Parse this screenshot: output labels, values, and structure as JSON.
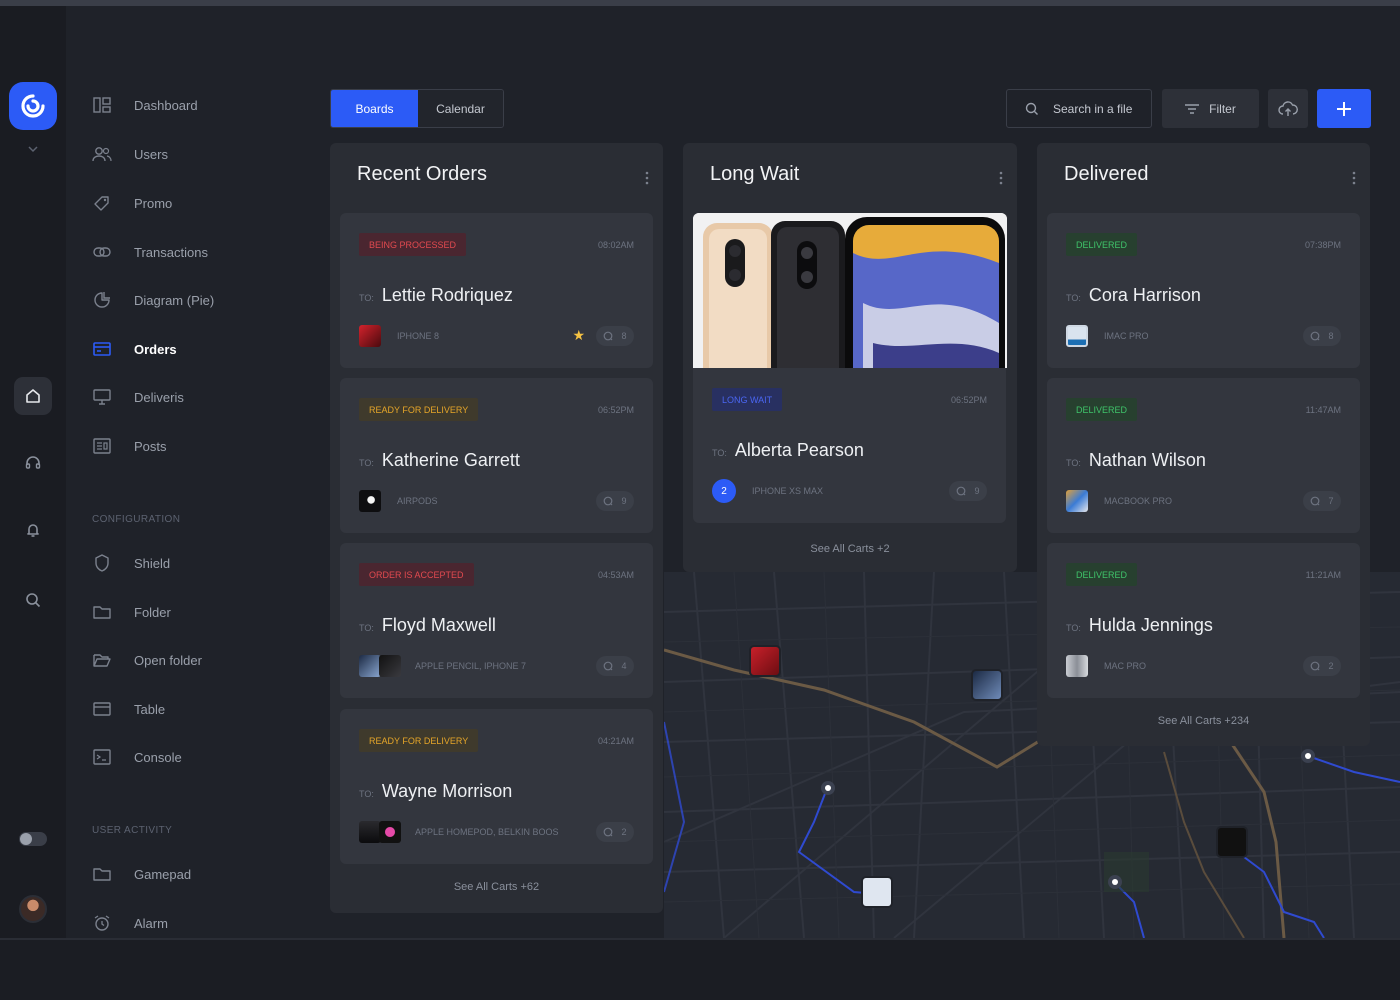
{
  "nav": {
    "items": [
      {
        "label": "Dashboard"
      },
      {
        "label": "Users"
      },
      {
        "label": "Promo"
      },
      {
        "label": "Transactions"
      },
      {
        "label": "Diagram (Pie)"
      },
      {
        "label": "Orders"
      },
      {
        "label": "Deliveris"
      },
      {
        "label": "Posts"
      }
    ],
    "config_heading": "CONFIGURATION",
    "config_items": [
      {
        "label": "Shield"
      },
      {
        "label": "Folder"
      },
      {
        "label": "Open folder"
      },
      {
        "label": "Table"
      },
      {
        "label": "Console"
      }
    ],
    "activity_heading": "USER ACTIVITY",
    "activity_items": [
      {
        "label": "Gamepad"
      },
      {
        "label": "Alarm"
      }
    ]
  },
  "toolbar": {
    "tabs": [
      {
        "label": "Boards"
      },
      {
        "label": "Calendar"
      }
    ],
    "search_label": "Search in a file",
    "filter_label": "Filter"
  },
  "columns": [
    {
      "title": "Recent Orders",
      "see_all": "See All Carts +62",
      "cards": [
        {
          "status": "BEING PROCESSED",
          "time": "08:02AM",
          "to": "TO:",
          "name": "Lettie Rodriquez",
          "product": "IPHONE 8",
          "comments": "8",
          "starred": true
        },
        {
          "status": "READY FOR DELIVERY",
          "time": "06:52PM",
          "to": "TO:",
          "name": "Katherine Garrett",
          "product": "AIRPODS",
          "comments": "9"
        },
        {
          "status": "ORDER IS ACCEPTED",
          "time": "04:53AM",
          "to": "TO:",
          "name": "Floyd Maxwell",
          "product": "APPLE PENCIL, IPHONE 7",
          "comments": "4"
        },
        {
          "status": "READY FOR DELIVERY",
          "time": "04:21AM",
          "to": "TO:",
          "name": "Wayne Morrison",
          "product": "APPLE HOMEPOD, BELKIN BOOS",
          "comments": "2"
        }
      ]
    },
    {
      "title": "Long Wait",
      "see_all": "See All Carts +2",
      "cards": [
        {
          "status": "LONG WAIT",
          "time": "06:52PM",
          "to": "TO:",
          "name": "Alberta Pearson",
          "product": "IPHONE XS MAX",
          "comments": "9",
          "count": "2"
        }
      ]
    },
    {
      "title": "Delivered",
      "see_all": "See All Carts +234",
      "cards": [
        {
          "status": "DELIVERED",
          "time": "07:38PM",
          "to": "TO:",
          "name": "Cora Harrison",
          "product": "IMAC PRO",
          "comments": "8"
        },
        {
          "status": "DELIVERED",
          "time": "11:47AM",
          "to": "TO:",
          "name": "Nathan Wilson",
          "product": "MACBOOK PRO",
          "comments": "7"
        },
        {
          "status": "DELIVERED",
          "time": "11:21AM",
          "to": "TO:",
          "name": "Hulda Jennings",
          "product": "MAC PRO",
          "comments": "2"
        }
      ]
    }
  ],
  "colors": {
    "accent": "#2c5bf6",
    "bg": "#1f2229",
    "panel": "#2a2d34",
    "card": "#33363e"
  },
  "icons": [
    "logo-icon",
    "home-icon",
    "support-icon",
    "bell-icon",
    "search-icon",
    "dashboard-icon",
    "users-icon",
    "promo-icon",
    "transactions-icon",
    "pie-icon",
    "orders-icon",
    "deliveries-icon",
    "posts-icon",
    "shield-icon",
    "folder-icon",
    "open-folder-icon",
    "table-icon",
    "console-icon",
    "gamepad-icon",
    "alarm-icon",
    "filter-icon",
    "upload-icon",
    "plus-icon",
    "comment-icon",
    "star-icon",
    "more-icon"
  ]
}
